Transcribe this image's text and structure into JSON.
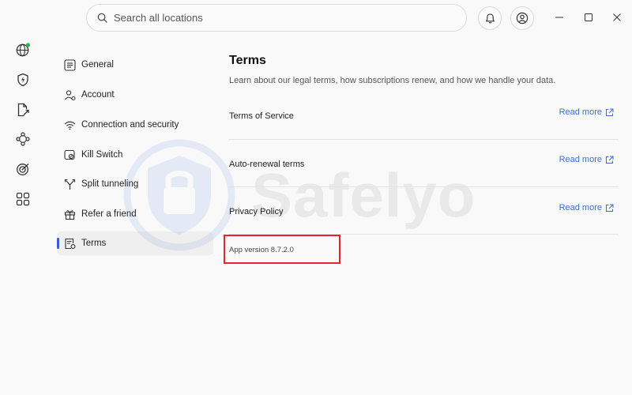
{
  "search": {
    "placeholder": "Search all locations"
  },
  "header_icons": [
    "bell-icon",
    "account-icon"
  ],
  "window_controls": [
    "minimize-icon",
    "maximize-icon",
    "close-icon"
  ],
  "rail": {
    "items": [
      "globe-icon",
      "shield-icon",
      "share-file-icon",
      "mesh-icon",
      "target-icon",
      "apps-grid-icon"
    ],
    "status_color": "#2fb14a"
  },
  "nav": {
    "items": [
      {
        "label": "General",
        "icon": "general-icon"
      },
      {
        "label": "Account",
        "icon": "account-icon"
      },
      {
        "label": "Connection and security",
        "icon": "wifi-icon"
      },
      {
        "label": "Kill Switch",
        "icon": "kill-switch-icon"
      },
      {
        "label": "Split tunneling",
        "icon": "split-icon"
      },
      {
        "label": "Refer a friend",
        "icon": "gift-icon"
      },
      {
        "label": "Terms",
        "icon": "terms-icon",
        "active": true
      }
    ],
    "accent": "#3a5bd9"
  },
  "main": {
    "title": "Terms",
    "subtitle": "Learn about our legal terms, how subscriptions renew, and how we handle your data.",
    "rows": [
      {
        "label": "Terms of Service",
        "action": "Read more"
      },
      {
        "label": "Auto-renewal terms",
        "action": "Read more"
      },
      {
        "label": "Privacy Policy",
        "action": "Read more"
      }
    ],
    "link_color": "#3a6fd6",
    "version": "App version 8.7.2.0",
    "highlight_color": "#e2262b"
  },
  "watermark": {
    "text": "Safelyo"
  }
}
